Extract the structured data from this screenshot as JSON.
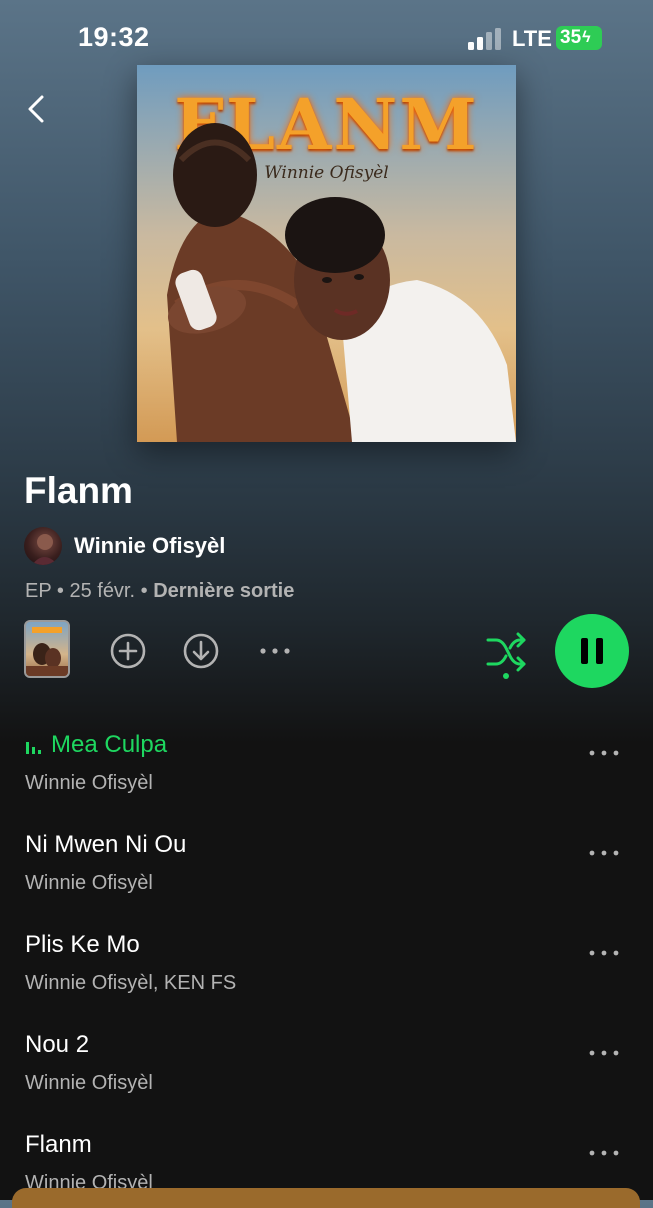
{
  "status_bar": {
    "time": "19:32",
    "network": "LTE",
    "battery": "35"
  },
  "cover": {
    "title_art": "FLANM",
    "subtitle_art": "Winnie Ofisyèl"
  },
  "album": {
    "title": "Flanm",
    "artist": "Winnie Ofisyèl",
    "type": "EP",
    "date": "25 févr.",
    "tag": "Dernière sortie"
  },
  "controls": {
    "add_icon": "plus-circle-icon",
    "download_icon": "download-circle-icon",
    "more_icon": "more-horizontal-icon",
    "shuffle_icon": "shuffle-icon",
    "play_state": "pause-icon"
  },
  "tracks": [
    {
      "title": "Mea Culpa",
      "artists": "Winnie Ofisyèl",
      "playing": true
    },
    {
      "title": "Ni Mwen Ni Ou",
      "artists": "Winnie Ofisyèl",
      "playing": false
    },
    {
      "title": "Plis Ke Mo",
      "artists": "Winnie Ofisyèl, KEN FS",
      "playing": false
    },
    {
      "title": "Nou 2",
      "artists": "Winnie Ofisyèl",
      "playing": false
    },
    {
      "title": "Flanm",
      "artists": "Winnie Ofisyèl",
      "playing": false
    }
  ],
  "colors": {
    "accent": "#1ed760",
    "muted": "#b3b3b3",
    "background": "#121212"
  }
}
